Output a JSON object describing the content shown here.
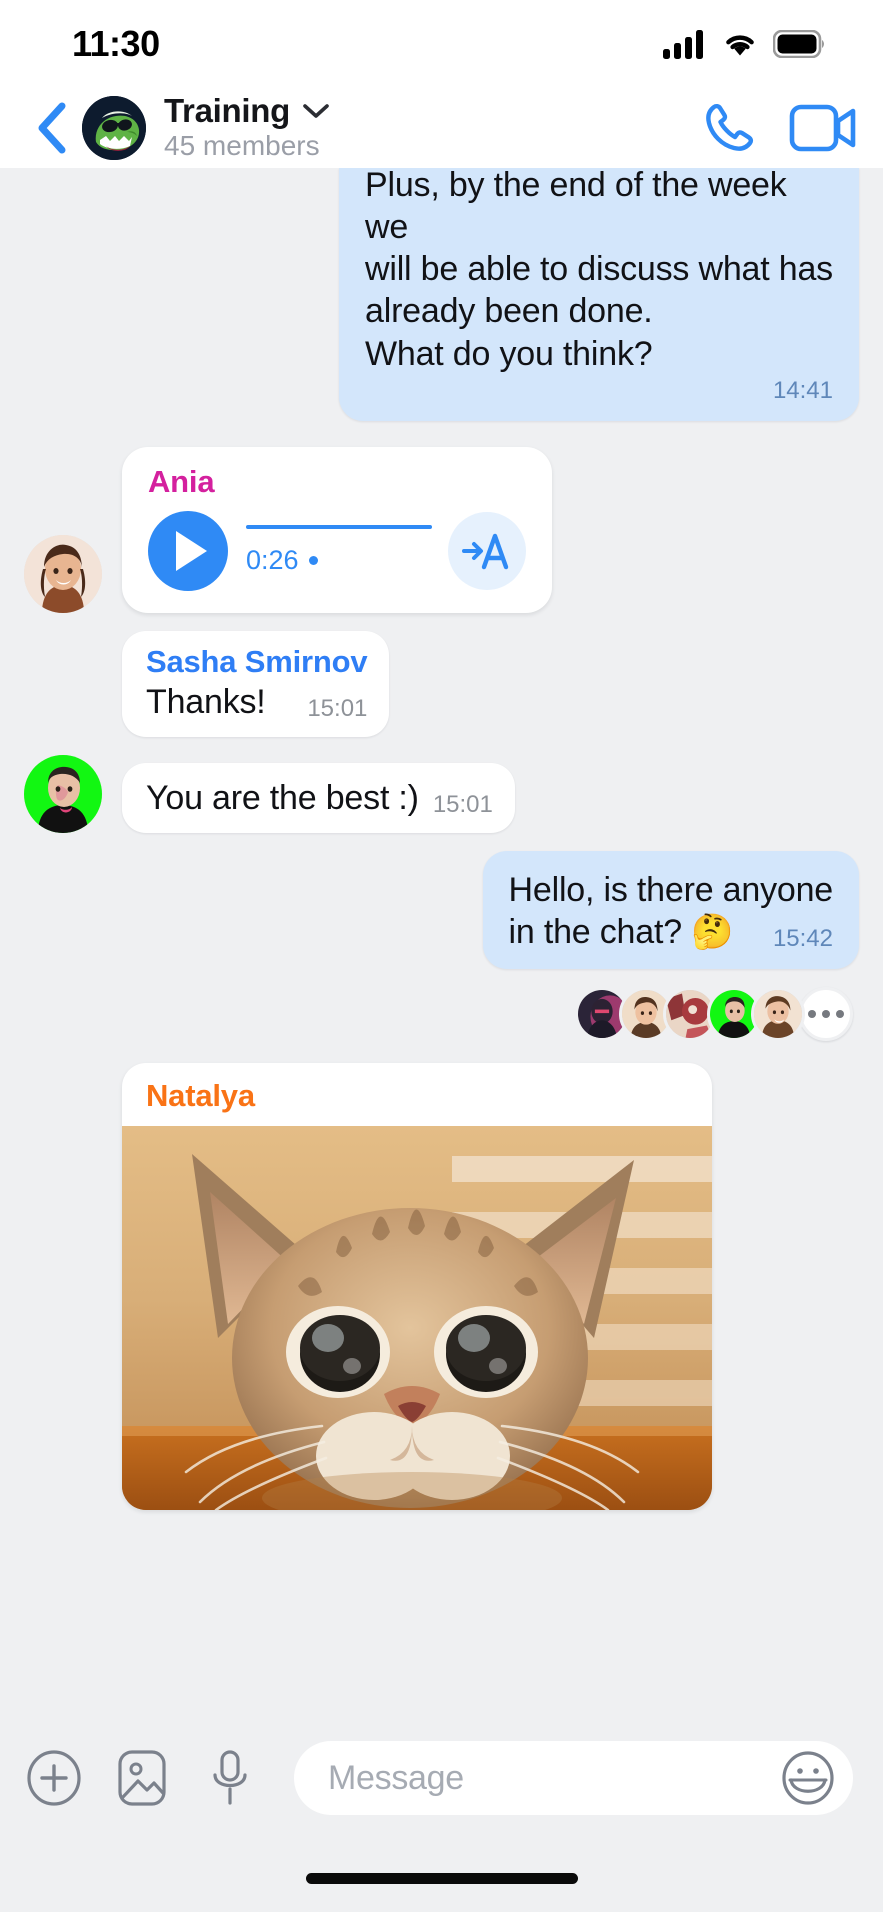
{
  "status_bar": {
    "time": "11:30",
    "signal_icon": "cellular-signal-icon",
    "wifi_icon": "wifi-icon",
    "battery_icon": "battery-full-icon"
  },
  "header": {
    "back_icon": "back-chevron-icon",
    "avatar_name": "group-avatar-dinosaur",
    "title": "Training",
    "dropdown_icon": "chevron-down-icon",
    "subtitle": "45 members",
    "call_icon": "phone-call-icon",
    "video_icon": "video-camera-icon"
  },
  "colors": {
    "accent_blue": "#2f8af5",
    "outgoing_bubble": "#d3e6fb",
    "incoming_bubble": "#ffffff",
    "chat_background": "#eff0f2",
    "sender_ania": "#d4209e",
    "sender_sasha": "#2f7ef5",
    "sender_natalya": "#f97316",
    "timestamp_gray": "#8e9298",
    "timestamp_blue": "#5f87b9"
  },
  "messages": [
    {
      "id": "msg-plan",
      "direction": "outgoing",
      "clipped": true,
      "lines": [
        "Plus, by the end of the week we",
        "will be able to discuss what has",
        "already been done.",
        "What do you think?"
      ],
      "time": "14:41"
    },
    {
      "id": "msg-voice",
      "direction": "incoming",
      "type": "voice",
      "sender": "Ania",
      "avatar": "avatar-ania",
      "play_icon": "play-icon",
      "duration": "0:26",
      "unplayed_dot": true,
      "transcribe_label": "→A",
      "transcribe_icon": "speech-to-text-icon"
    },
    {
      "id": "msg-thanks",
      "direction": "incoming",
      "type": "text",
      "sender": "Sasha Smirnov",
      "text": "Thanks!",
      "time": "15:01"
    },
    {
      "id": "msg-best",
      "direction": "incoming",
      "type": "text",
      "avatar": "avatar-sasha",
      "text": "You are the best :)",
      "time": "15:01"
    },
    {
      "id": "msg-hello",
      "direction": "outgoing",
      "type": "text",
      "lines": [
        "Hello, is there anyone",
        "in the chat? 🤔"
      ],
      "time": "15:42"
    },
    {
      "id": "msg-photo",
      "direction": "incoming",
      "type": "photo",
      "sender": "Natalya",
      "photo_alt": "photo-cat"
    }
  ],
  "seen_by": {
    "avatars": [
      "seen-avatar-1",
      "seen-avatar-2",
      "seen-avatar-3",
      "seen-avatar-4",
      "seen-avatar-5"
    ],
    "more_label": "more-reactions"
  },
  "input_bar": {
    "attach_icon": "plus-circle-icon",
    "gallery_icon": "photo-icon",
    "mic_icon": "microphone-icon",
    "placeholder": "Message",
    "emoji_icon": "smiley-face-icon"
  },
  "home_indicator": "home-indicator"
}
